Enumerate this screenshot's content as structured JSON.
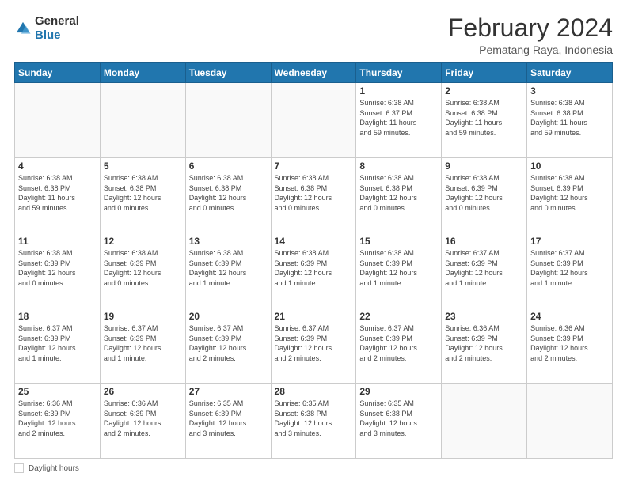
{
  "header": {
    "logo": {
      "line1": "General",
      "line2": "Blue"
    },
    "title": "February 2024",
    "location": "Pematang Raya, Indonesia"
  },
  "days_of_week": [
    "Sunday",
    "Monday",
    "Tuesday",
    "Wednesday",
    "Thursday",
    "Friday",
    "Saturday"
  ],
  "weeks": [
    [
      {
        "day": "",
        "info": ""
      },
      {
        "day": "",
        "info": ""
      },
      {
        "day": "",
        "info": ""
      },
      {
        "day": "",
        "info": ""
      },
      {
        "day": "1",
        "info": "Sunrise: 6:38 AM\nSunset: 6:37 PM\nDaylight: 11 hours\nand 59 minutes."
      },
      {
        "day": "2",
        "info": "Sunrise: 6:38 AM\nSunset: 6:38 PM\nDaylight: 11 hours\nand 59 minutes."
      },
      {
        "day": "3",
        "info": "Sunrise: 6:38 AM\nSunset: 6:38 PM\nDaylight: 11 hours\nand 59 minutes."
      }
    ],
    [
      {
        "day": "4",
        "info": "Sunrise: 6:38 AM\nSunset: 6:38 PM\nDaylight: 11 hours\nand 59 minutes."
      },
      {
        "day": "5",
        "info": "Sunrise: 6:38 AM\nSunset: 6:38 PM\nDaylight: 12 hours\nand 0 minutes."
      },
      {
        "day": "6",
        "info": "Sunrise: 6:38 AM\nSunset: 6:38 PM\nDaylight: 12 hours\nand 0 minutes."
      },
      {
        "day": "7",
        "info": "Sunrise: 6:38 AM\nSunset: 6:38 PM\nDaylight: 12 hours\nand 0 minutes."
      },
      {
        "day": "8",
        "info": "Sunrise: 6:38 AM\nSunset: 6:38 PM\nDaylight: 12 hours\nand 0 minutes."
      },
      {
        "day": "9",
        "info": "Sunrise: 6:38 AM\nSunset: 6:39 PM\nDaylight: 12 hours\nand 0 minutes."
      },
      {
        "day": "10",
        "info": "Sunrise: 6:38 AM\nSunset: 6:39 PM\nDaylight: 12 hours\nand 0 minutes."
      }
    ],
    [
      {
        "day": "11",
        "info": "Sunrise: 6:38 AM\nSunset: 6:39 PM\nDaylight: 12 hours\nand 0 minutes."
      },
      {
        "day": "12",
        "info": "Sunrise: 6:38 AM\nSunset: 6:39 PM\nDaylight: 12 hours\nand 0 minutes."
      },
      {
        "day": "13",
        "info": "Sunrise: 6:38 AM\nSunset: 6:39 PM\nDaylight: 12 hours\nand 1 minute."
      },
      {
        "day": "14",
        "info": "Sunrise: 6:38 AM\nSunset: 6:39 PM\nDaylight: 12 hours\nand 1 minute."
      },
      {
        "day": "15",
        "info": "Sunrise: 6:38 AM\nSunset: 6:39 PM\nDaylight: 12 hours\nand 1 minute."
      },
      {
        "day": "16",
        "info": "Sunrise: 6:37 AM\nSunset: 6:39 PM\nDaylight: 12 hours\nand 1 minute."
      },
      {
        "day": "17",
        "info": "Sunrise: 6:37 AM\nSunset: 6:39 PM\nDaylight: 12 hours\nand 1 minute."
      }
    ],
    [
      {
        "day": "18",
        "info": "Sunrise: 6:37 AM\nSunset: 6:39 PM\nDaylight: 12 hours\nand 1 minute."
      },
      {
        "day": "19",
        "info": "Sunrise: 6:37 AM\nSunset: 6:39 PM\nDaylight: 12 hours\nand 1 minute."
      },
      {
        "day": "20",
        "info": "Sunrise: 6:37 AM\nSunset: 6:39 PM\nDaylight: 12 hours\nand 2 minutes."
      },
      {
        "day": "21",
        "info": "Sunrise: 6:37 AM\nSunset: 6:39 PM\nDaylight: 12 hours\nand 2 minutes."
      },
      {
        "day": "22",
        "info": "Sunrise: 6:37 AM\nSunset: 6:39 PM\nDaylight: 12 hours\nand 2 minutes."
      },
      {
        "day": "23",
        "info": "Sunrise: 6:36 AM\nSunset: 6:39 PM\nDaylight: 12 hours\nand 2 minutes."
      },
      {
        "day": "24",
        "info": "Sunrise: 6:36 AM\nSunset: 6:39 PM\nDaylight: 12 hours\nand 2 minutes."
      }
    ],
    [
      {
        "day": "25",
        "info": "Sunrise: 6:36 AM\nSunset: 6:39 PM\nDaylight: 12 hours\nand 2 minutes."
      },
      {
        "day": "26",
        "info": "Sunrise: 6:36 AM\nSunset: 6:39 PM\nDaylight: 12 hours\nand 2 minutes."
      },
      {
        "day": "27",
        "info": "Sunrise: 6:35 AM\nSunset: 6:39 PM\nDaylight: 12 hours\nand 3 minutes."
      },
      {
        "day": "28",
        "info": "Sunrise: 6:35 AM\nSunset: 6:38 PM\nDaylight: 12 hours\nand 3 minutes."
      },
      {
        "day": "29",
        "info": "Sunrise: 6:35 AM\nSunset: 6:38 PM\nDaylight: 12 hours\nand 3 minutes."
      },
      {
        "day": "",
        "info": ""
      },
      {
        "day": "",
        "info": ""
      }
    ]
  ],
  "footer": {
    "label": "Daylight hours"
  }
}
